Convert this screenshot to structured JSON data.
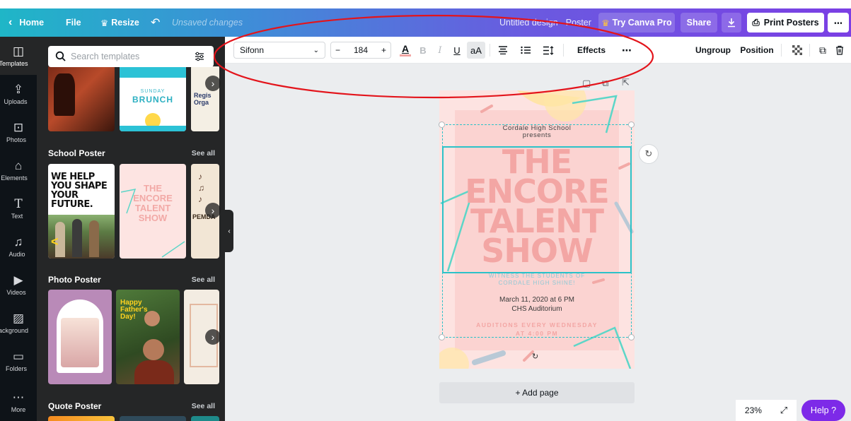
{
  "header": {
    "home_label": "Home",
    "file_label": "File",
    "resize_label": "Resize",
    "status_text": "Unsaved changes",
    "design_title": "Untitled design - Poster",
    "try_pro_label": "Try Canva Pro",
    "share_label": "Share",
    "print_label": "Print Posters",
    "more_label": "⋯"
  },
  "rail": {
    "items": [
      {
        "label": "Templates",
        "icon": "templates-icon"
      },
      {
        "label": "Uploads",
        "icon": "upload-icon"
      },
      {
        "label": "Photos",
        "icon": "photos-icon"
      },
      {
        "label": "Elements",
        "icon": "elements-icon"
      },
      {
        "label": "Text",
        "icon": "text-icon"
      },
      {
        "label": "Audio",
        "icon": "audio-icon"
      },
      {
        "label": "Videos",
        "icon": "videos-icon"
      },
      {
        "label": "Background",
        "icon": "background-icon"
      },
      {
        "label": "Folders",
        "icon": "folders-icon"
      },
      {
        "label": "More",
        "icon": "more-icon"
      }
    ]
  },
  "panel": {
    "search_placeholder": "Search templates",
    "sections": [
      {
        "title": "School Poster",
        "see_all": "See all"
      },
      {
        "title": "Photo Poster",
        "see_all": "See all"
      },
      {
        "title": "Quote Poster",
        "see_all": "See all"
      }
    ],
    "top_thumb": {
      "line1": "SUNDAY",
      "line2": "BRUNCH",
      "side_text": "Regis Orga"
    },
    "school_thumbs": [
      {
        "line1": "WE HELP",
        "line2": "YOU SHAPE",
        "line3": "YOUR FUTURE."
      },
      {
        "line1": "THE",
        "line2": "ENCORE",
        "line3": "TALENT",
        "line4": "SHOW"
      },
      {
        "line1": "PEMDA"
      }
    ],
    "photo_thumbs": [
      {
        "line1": "Happy",
        "line2": "Father's",
        "line3": "Day!"
      }
    ]
  },
  "toolbar": {
    "font_name": "Sifonn",
    "font_size": "184",
    "decrease": "−",
    "increase": "+",
    "color_letter": "A",
    "bold": "B",
    "italic": "I",
    "underline": "U",
    "case": "aA",
    "effects_label": "Effects",
    "more": "⋯",
    "ungroup_label": "Ungroup",
    "position_label": "Position"
  },
  "poster": {
    "school": "Cordale High School",
    "presents": "presents",
    "title_lines": [
      "THE",
      "ENCORE",
      "TALENT",
      "SHOW"
    ],
    "tagline1": "WITNESS THE STUDENTS OF",
    "tagline2": "CORDALE HIGH SHINE!",
    "date": "March 11, 2020 at 6 PM",
    "venue": "CHS Auditorium",
    "auditions1": "AUDITIONS EVERY WEDNESDAY",
    "auditions2": "AT 4:00 PM"
  },
  "canvas": {
    "add_page_label": "+ Add page",
    "zoom_label": "23%",
    "help_label": "Help ?"
  },
  "colors": {
    "accent_purple": "#7d2ae8",
    "poster_pink": "#f3a6a4",
    "poster_teal": "#5dd6c8",
    "annotation_red": "#e3141b"
  }
}
